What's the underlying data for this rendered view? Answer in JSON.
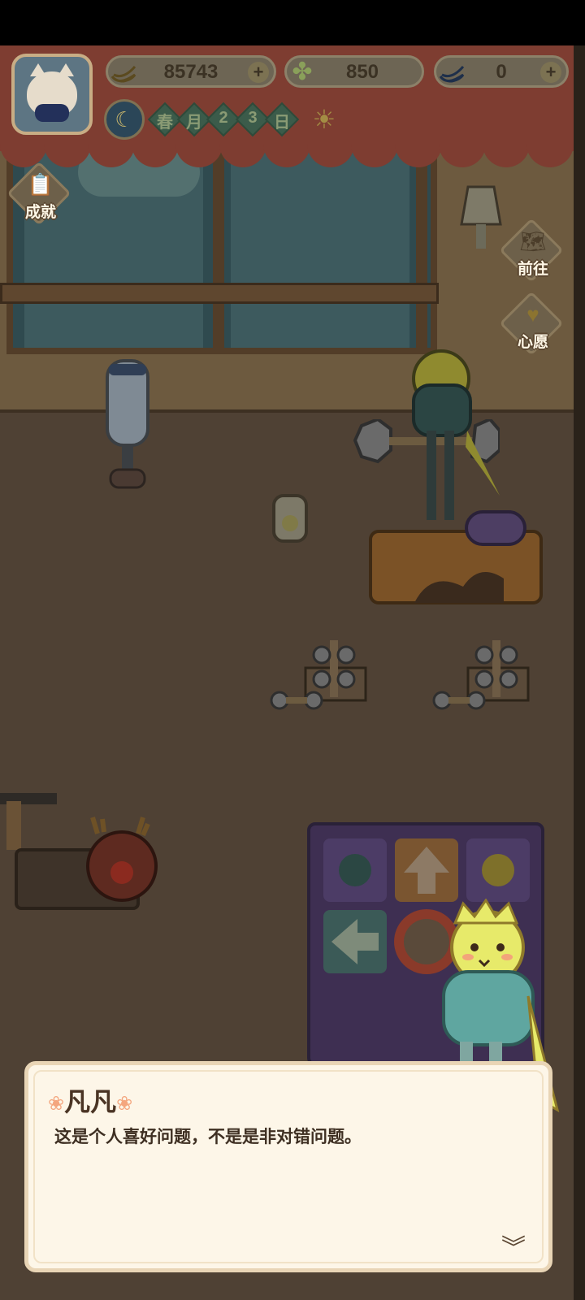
{
  "hud": {
    "currencies": [
      {
        "icon": "banana-icon",
        "value": "85743",
        "has_plus": true
      },
      {
        "icon": "clover-icon",
        "value": "850",
        "has_plus": false
      },
      {
        "icon": "blue-banana-icon",
        "value": "0",
        "has_plus": true
      }
    ],
    "date": {
      "season": "春",
      "month_unit": "月",
      "day_digit_1": "2",
      "day_digit_2": "3",
      "day_unit": "日"
    },
    "weather_icon": "sun-icon"
  },
  "side_buttons": {
    "achievements": "成就",
    "goto": "前往",
    "wish": "心愿"
  },
  "dialog": {
    "speaker": "凡凡",
    "text": "这是个人喜好问题，不是是非对错问题。"
  },
  "colors": {
    "curtain": "#7e3d31",
    "floor": "#4f4134",
    "dialog_bg": "#fdf6e8",
    "paw": "#f4a67e"
  }
}
